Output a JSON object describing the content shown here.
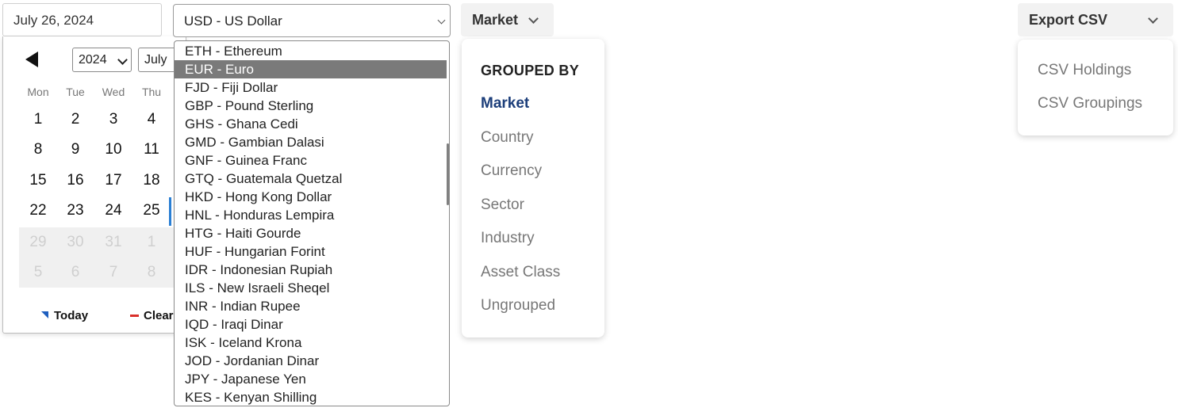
{
  "date_input": {
    "value": "July 26, 2024"
  },
  "calendar": {
    "year": "2024",
    "month": "July",
    "weekdays": [
      "Mon",
      "Tue",
      "Wed",
      "Thu"
    ],
    "weeks": [
      [
        "1",
        "2",
        "3",
        "4"
      ],
      [
        "8",
        "9",
        "10",
        "11"
      ],
      [
        "15",
        "16",
        "17",
        "18"
      ],
      [
        "22",
        "23",
        "24",
        "25"
      ],
      [
        "29",
        "30",
        "31",
        "1"
      ],
      [
        "5",
        "6",
        "7",
        "8"
      ]
    ],
    "today_label": "Today",
    "clear_label": "Clear",
    "colors": {
      "selected_marker": "#2a7fd4",
      "today_icon": "#1f5fbf",
      "clear_icon": "#d9302a"
    }
  },
  "currency": {
    "selected": "USD - US Dollar",
    "highlighted": "EUR - Euro",
    "options": [
      "ETH - Ethereum",
      "EUR - Euro",
      "FJD - Fiji Dollar",
      "GBP - Pound Sterling",
      "GHS - Ghana Cedi",
      "GMD - Gambian Dalasi",
      "GNF - Guinea Franc",
      "GTQ - Guatemala Quetzal",
      "HKD - Hong Kong Dollar",
      "HNL - Honduras Lempira",
      "HTG - Haiti Gourde",
      "HUF - Hungarian Forint",
      "IDR - Indonesian Rupiah",
      "ILS - New Israeli Sheqel",
      "INR - Indian Rupee",
      "IQD - Iraqi Dinar",
      "ISK - Iceland Krona",
      "JOD - Jordanian Dinar",
      "JPY - Japanese Yen",
      "KES - Kenyan Shilling"
    ]
  },
  "grouping": {
    "button_label": "Market",
    "heading": "GROUPED BY",
    "active": "Market",
    "items": [
      "Market",
      "Country",
      "Currency",
      "Sector",
      "Industry",
      "Asset Class",
      "Ungrouped"
    ],
    "colors": {
      "active": "#1c3e7a"
    }
  },
  "export": {
    "button_label": "Export CSV",
    "items": [
      "CSV Holdings",
      "CSV Groupings"
    ]
  }
}
